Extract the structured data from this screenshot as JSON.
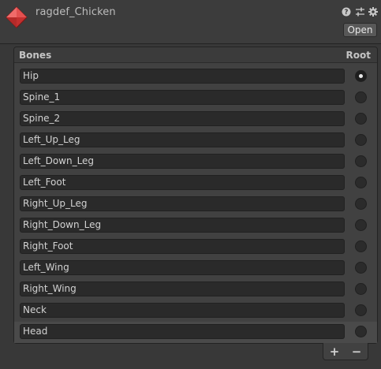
{
  "header": {
    "title": "ragdef_Chicken",
    "open_label": "Open",
    "icons": [
      "help-icon",
      "presets-icon",
      "settings-gear-icon"
    ]
  },
  "list": {
    "bones_header": "Bones",
    "root_header": "Root",
    "items": [
      {
        "name": "Hip",
        "root": true
      },
      {
        "name": "Spine_1",
        "root": false
      },
      {
        "name": "Spine_2",
        "root": false
      },
      {
        "name": "Left_Up_Leg",
        "root": false
      },
      {
        "name": "Left_Down_Leg",
        "root": false
      },
      {
        "name": "Left_Foot",
        "root": false
      },
      {
        "name": "Right_Up_Leg",
        "root": false
      },
      {
        "name": "Right_Down_Leg",
        "root": false
      },
      {
        "name": "Right_Foot",
        "root": false
      },
      {
        "name": "Left_Wing",
        "root": false
      },
      {
        "name": "Right_Wing",
        "root": false
      },
      {
        "name": "Neck",
        "root": false
      },
      {
        "name": "Head",
        "root": false
      }
    ],
    "selected_index": 12
  },
  "footer": {
    "add_label": "+",
    "remove_label": "−"
  },
  "colors": {
    "asset_icon": "#d83a3a",
    "background": "#383838"
  }
}
